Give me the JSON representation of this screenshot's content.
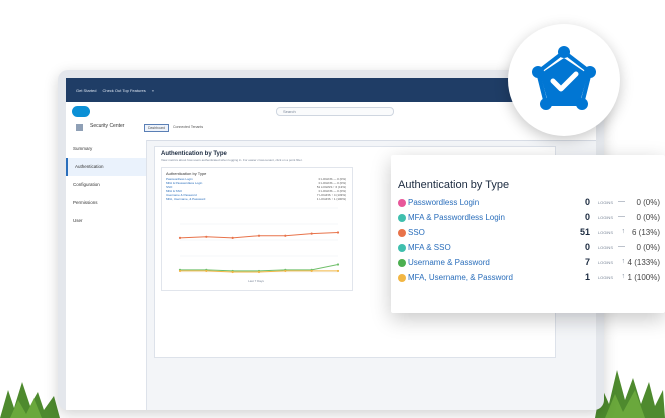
{
  "topbar": {
    "items": [
      "Get Started",
      "Check Out Top Features"
    ],
    "chevron": "»"
  },
  "navbar": {
    "search_placeholder": "Search",
    "app_name": "Security Center",
    "tabs": [
      {
        "label": "Dashboard",
        "active": true
      },
      {
        "label": "Connected Tenants",
        "active": false
      }
    ]
  },
  "sidebar": {
    "items": [
      {
        "label": "Summary",
        "active": false
      },
      {
        "label": "Authentication",
        "active": true
      },
      {
        "label": "Configuration",
        "active": false
      },
      {
        "label": "Permissions",
        "active": false
      },
      {
        "label": "User",
        "active": false
      }
    ]
  },
  "content": {
    "title": "Authentication by Type",
    "subtitle": "View metrics about how users authenticated when logging in. For easier cross-tenant, click on a point filter.",
    "mini_card": {
      "title": "Authentication by Type",
      "rows": [
        {
          "label": "Passwordless Login",
          "value": "0 LOGINS — 0 (0%)"
        },
        {
          "label": "MFA & Passwordless Login",
          "value": "0 LOGINS — 0 (0%)"
        },
        {
          "label": "SSO",
          "value": "51 LOGINS ↑ 6 (13%)"
        },
        {
          "label": "MFA & SSO",
          "value": "0 LOGINS — 0 (0%)"
        },
        {
          "label": "Username & Password",
          "value": "7 LOGINS ↑ 4 (133%)"
        },
        {
          "label": "MFA, Username, & Password",
          "value": "1 LOGINS ↑ 1 (100%)"
        }
      ],
      "xlabel": "Last 7 Days"
    }
  },
  "chart_data": {
    "type": "line",
    "xlabel": "Last 7 Days",
    "ylabel": "",
    "series": [
      {
        "name": "SSO",
        "color": "#e8734a",
        "values": [
          32,
          33,
          32,
          34,
          34,
          36,
          37
        ]
      },
      {
        "name": "Username & Password",
        "color": "#6fbf6a",
        "values": [
          2,
          2,
          1,
          1,
          2,
          2,
          7
        ]
      },
      {
        "name": "MFA, Username, & Password",
        "color": "#f2b643",
        "values": [
          1,
          1,
          0,
          0,
          1,
          1,
          1
        ]
      }
    ],
    "ylim": [
      0,
      60
    ],
    "grid": true
  },
  "overlay": {
    "title": "Authentication by Type",
    "rows": [
      {
        "label": "Passwordless Login",
        "color": "#e8579a",
        "count": "0",
        "unit": "LOGINS",
        "arrow": "—",
        "change": "0 (0%)"
      },
      {
        "label": "MFA & Passwordless Login",
        "color": "#3fbfae",
        "count": "0",
        "unit": "LOGINS",
        "arrow": "—",
        "change": "0 (0%)"
      },
      {
        "label": "SSO",
        "color": "#e8734a",
        "count": "51",
        "unit": "LOGINS",
        "arrow": "↑",
        "change": "6 (13%)"
      },
      {
        "label": "MFA & SSO",
        "color": "#3fbfae",
        "count": "0",
        "unit": "LOGINS",
        "arrow": "—",
        "change": "0 (0%)"
      },
      {
        "label": "Username & Password",
        "color": "#4caf50",
        "count": "7",
        "unit": "LOGINS",
        "arrow": "↑",
        "change": "4 (133%)"
      },
      {
        "label": "MFA, Username, & Password",
        "color": "#f2b643",
        "count": "1",
        "unit": "LOGINS",
        "arrow": "↑",
        "change": "1 (100%)"
      }
    ]
  },
  "badge": {
    "icon": "shield-network-check-icon",
    "color": "#0176d3"
  },
  "colors": {
    "brand": "#0176d3",
    "nav": "#1f3d66",
    "plant": "#4e8a2e"
  }
}
